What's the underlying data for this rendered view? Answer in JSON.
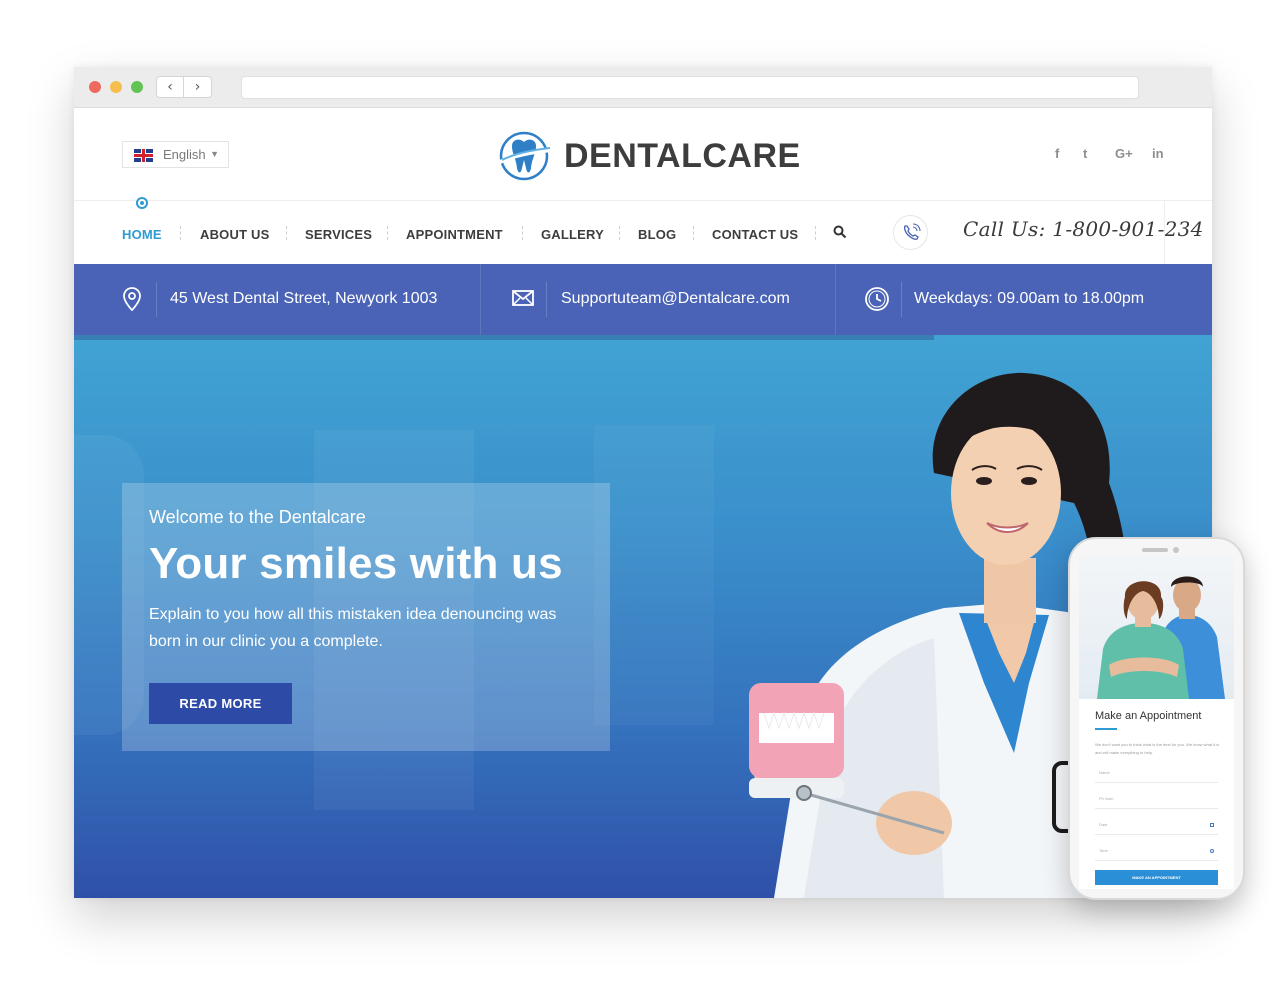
{
  "browser": {
    "back_icon": "‹",
    "forward_icon": "›"
  },
  "header": {
    "language": "English",
    "brand": "DENTALCARE",
    "social": {
      "facebook": "f",
      "twitter": "t",
      "google_plus": "G+",
      "linkedin": "in"
    }
  },
  "nav": {
    "items": [
      {
        "label": "HOME",
        "active": true
      },
      {
        "label": "ABOUT US"
      },
      {
        "label": "SERVICES"
      },
      {
        "label": "APPOINTMENT"
      },
      {
        "label": "GALLERY"
      },
      {
        "label": "BLOG"
      },
      {
        "label": "CONTACT US"
      }
    ],
    "call": "Call Us: 1-800-901-234"
  },
  "infobar": {
    "address": "45 West Dental Street, Newyork 1003",
    "email": "Supportuteam@Dentalcare.com",
    "hours": "Weekdays: 09.00am to 18.00pm"
  },
  "hero": {
    "welcome": "Welcome to the Dentalcare",
    "headline": "Your smiles with us",
    "description": "Explain to you how all this mistaken idea denouncing was born in our clinic you a complete.",
    "button": "READ MORE"
  },
  "mobile": {
    "title": "Make an Appointment",
    "intro": "We don't want you to think what is the best for you. We know what it is and will make everything to help.",
    "fields": [
      "Name",
      "Ph Num",
      "Date",
      "Time"
    ],
    "button": "MAKE AN APPOINTMENT"
  },
  "colors": {
    "accent": "#2f9bd3",
    "infobar": "#4a63b6",
    "button": "#2d4aa6"
  }
}
